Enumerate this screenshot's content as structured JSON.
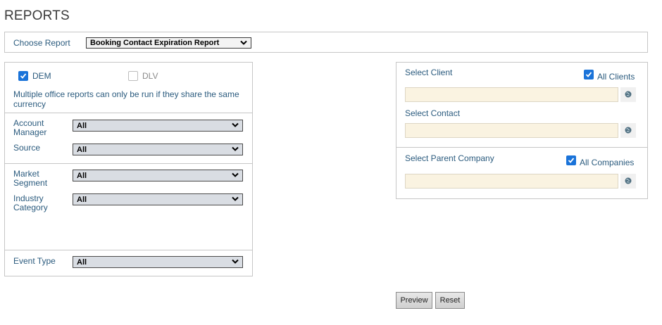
{
  "page": {
    "title": "REPORTS"
  },
  "choose_report": {
    "label": "Choose Report",
    "selected": "Booking Contact Expiration Report"
  },
  "offices": {
    "dem": {
      "label": "DEM",
      "checked": true
    },
    "dlv": {
      "label": "DLV",
      "checked": false
    },
    "note": "Multiple office reports can only be run if they share the same currency"
  },
  "filters": {
    "account_manager": {
      "label": "Account Manager",
      "value": "All"
    },
    "source": {
      "label": "Source",
      "value": "All"
    },
    "market_segment": {
      "label": "Market Segment",
      "value": "All"
    },
    "industry_category": {
      "label": "Industry Category",
      "value": "All"
    },
    "event_type": {
      "label": "Event Type",
      "value": "All"
    }
  },
  "client": {
    "label": "Select Client",
    "all_label": "All Clients",
    "all_checked": true,
    "value": ""
  },
  "contact": {
    "label": "Select Contact",
    "value": ""
  },
  "parent_company": {
    "label": "Select Parent Company",
    "all_label": "All Companies",
    "all_checked": true,
    "value": ""
  },
  "actions": {
    "preview": "Preview",
    "reset": "Reset"
  },
  "colors": {
    "label_text": "#2b5b7e",
    "checkbox_blue": "#1a73d9",
    "lookup_bg": "#faf3e1",
    "select_bg": "#d9dde3"
  },
  "icons": {
    "lookup": "globe-icon",
    "dropdown": "chevron-down-icon",
    "check": "checkmark-icon"
  }
}
